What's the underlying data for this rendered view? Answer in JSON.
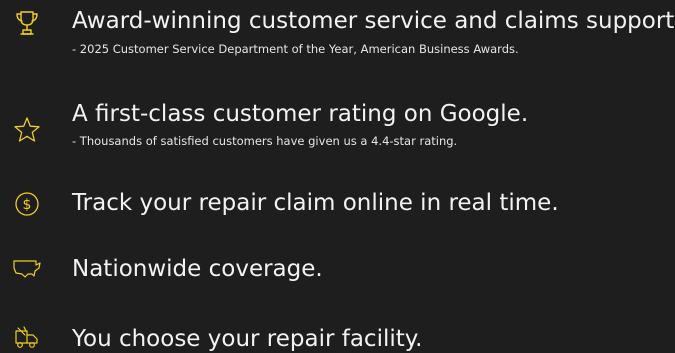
{
  "accent_color": "#f0cf1e",
  "features": [
    {
      "icon": "trophy-icon",
      "headline": "Award-winning customer service and claims support.",
      "sub": "- 2025 Customer Service Department of the Year, American Business Awards."
    },
    {
      "icon": "star-icon",
      "headline": "A first-class customer rating on Google.",
      "sub": "- Thousands of satisfied customers have given us a 4.4-star rating."
    },
    {
      "icon": "dollar-icon",
      "headline": "Track your repair claim online in real time."
    },
    {
      "icon": "usa-map-icon",
      "headline": "Nationwide coverage."
    },
    {
      "icon": "tow-truck-icon",
      "headline": "You choose your repair facility."
    }
  ]
}
